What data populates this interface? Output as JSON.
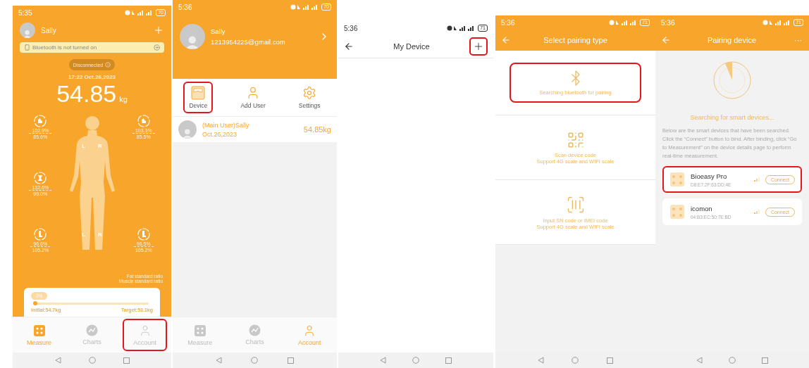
{
  "measure_screen": {
    "status_bar": {
      "time": "5:35",
      "battery": "70"
    },
    "user_name": "Sally",
    "bluetooth_banner": "Bluetooth is not turned on",
    "connection_status": "Disconnected",
    "date": "17:22 Oct.26,2023",
    "weight": "54.85",
    "unit": "kg",
    "left_segments": [
      {
        "kind": "arm",
        "fat": "102.9%",
        "muscle": "85.6%"
      },
      {
        "kind": "trunk",
        "fat": "132.6%",
        "muscle": "99.0%"
      },
      {
        "kind": "leg",
        "fat": "96.6%",
        "muscle": "105.2%"
      }
    ],
    "right_segments": [
      {
        "kind": "arm",
        "fat": "103.3%",
        "muscle": "85.5%"
      },
      {
        "kind": "leg",
        "fat": "96.5%",
        "muscle": "105.2%"
      }
    ],
    "body_labels_upper": [
      "L",
      "R"
    ],
    "body_labels_lower": [
      "L",
      "R"
    ],
    "legend": [
      "Fat standard ratio",
      "Muscle standard ratio"
    ],
    "goal": {
      "percent": "0%",
      "level": 0,
      "initial": "Initial:54.7kg",
      "target": "Target:53.1kg"
    },
    "tabs": [
      {
        "kind": "measure",
        "label": "Measure",
        "selected": true,
        "highlighted": false
      },
      {
        "kind": "charts",
        "label": "Charts",
        "selected": false,
        "highlighted": false
      },
      {
        "kind": "account",
        "label": "Account",
        "selected": false,
        "highlighted": true
      }
    ]
  },
  "account_screen": {
    "status_bar": {
      "time": "5:36",
      "battery": "70"
    },
    "user_name": "Sally",
    "email": "1213954225@gmail.com",
    "menu": [
      {
        "kind": "device",
        "label": "Device",
        "highlighted": true
      },
      {
        "kind": "add_user",
        "label": "Add User",
        "highlighted": false
      },
      {
        "kind": "settings",
        "label": "Settings",
        "highlighted": false
      }
    ],
    "user_row": {
      "name": "(Main User)Sally",
      "date": "Oct.26,2023",
      "weight": "54.85kg"
    },
    "tabs": [
      {
        "kind": "measure",
        "label": "Measure",
        "selected": false,
        "highlighted": false
      },
      {
        "kind": "charts",
        "label": "Charts",
        "selected": false,
        "highlighted": false
      },
      {
        "kind": "account",
        "label": "Account",
        "selected": true,
        "highlighted": false
      }
    ]
  },
  "my_device_screen": {
    "status_bar": {
      "time": "5:36",
      "battery": "71"
    },
    "title": "My Device",
    "add_button": {
      "highlighted": true
    }
  },
  "pairing_type_screen": {
    "status_bar": {
      "time": "5:36",
      "battery": "71"
    },
    "title": "Select pairing type",
    "options": [
      {
        "kind": "bluetooth",
        "lines": [
          "Searching bluetooth for pairing"
        ],
        "highlighted": true
      },
      {
        "kind": "qr",
        "lines": [
          "Scan device code",
          "Support 4G scale and WIFI scale"
        ],
        "highlighted": false
      },
      {
        "kind": "sn",
        "lines": [
          "Input SN code or IMEI code",
          "Support 4G scale and WIFI scale"
        ],
        "highlighted": false
      }
    ]
  },
  "pairing_device_screen": {
    "status_bar": {
      "time": "5:36",
      "battery": "71"
    },
    "title": "Pairing device",
    "more": "···",
    "searching": "Searching for smart devices...",
    "description": "Below are the smart devices that have been searched. Click the “Connect” button to bind. After binding, click “Go to Measurement” on the device details page to perform real-time measurement.",
    "devices": [
      {
        "name": "Bioeasy Pro",
        "mac": "D8:E7:2F:63:DD:4E",
        "button": "Connect",
        "highlighted": true
      },
      {
        "name": "icomon",
        "mac": "04:B3:EC:50:7E:BD",
        "button": "Connect",
        "highlighted": false
      }
    ]
  }
}
